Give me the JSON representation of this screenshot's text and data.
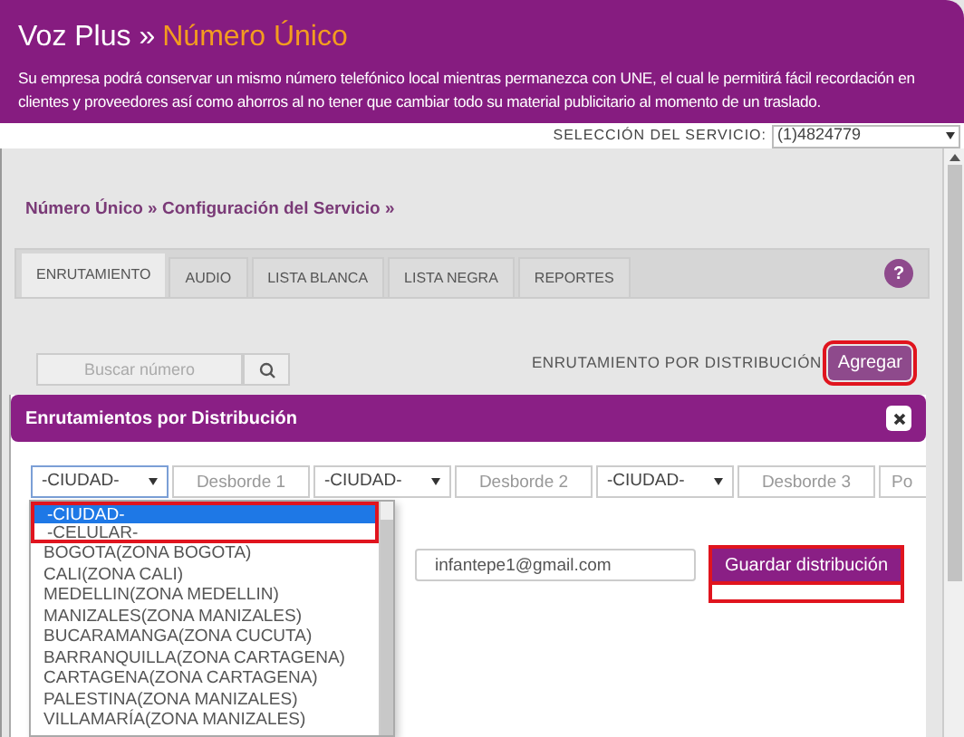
{
  "header": {
    "title": "Voz Plus »",
    "title_highlight": "Número Único",
    "description": "Su empresa podrá conservar un mismo número telefónico local mientras permanezca con UNE, el cual le permitirá fácil recordación en clientes y proveedores así como ahorros al no tener que cambiar todo su material publicitario al momento de un traslado."
  },
  "service_selection": {
    "label": "SELECCIÓN DEL SERVICIO:",
    "value": "(1)4824779"
  },
  "breadcrumb": "Número Único » Configuración del Servicio »",
  "tabs": [
    {
      "label": "ENRUTAMIENTO",
      "selected": true
    },
    {
      "label": "AUDIO",
      "selected": false
    },
    {
      "label": "LISTA BLANCA",
      "selected": false
    },
    {
      "label": "LISTA NEGRA",
      "selected": false
    },
    {
      "label": "REPORTES",
      "selected": false
    }
  ],
  "help_button": "?",
  "search": {
    "placeholder": "Buscar número"
  },
  "distribution": {
    "label": "ENRUTAMIENTO POR DISTRIBUCIÓN",
    "button": "Agregar",
    "highlighted": true
  },
  "dialog": {
    "title": "Enrutamientos por Distribución",
    "fields": [
      {
        "kind": "select",
        "value": "-CIUDAD-",
        "focused": true
      },
      {
        "kind": "input",
        "placeholder": "Desborde 1"
      },
      {
        "kind": "select",
        "value": "-CIUDAD-",
        "focused": false
      },
      {
        "kind": "input",
        "placeholder": "Desborde 2"
      },
      {
        "kind": "select",
        "value": "-CIUDAD-",
        "focused": false
      },
      {
        "kind": "input",
        "placeholder": "Desborde 3"
      },
      {
        "kind": "input",
        "placeholder": "Po"
      }
    ],
    "email": {
      "value": "infantepe1@gmail.com"
    },
    "save_button": {
      "label": "Guardar distribución",
      "highlighted": true
    },
    "dropdown_options": [
      {
        "label": "-CIUDAD-",
        "selected": true,
        "highlighted": true
      },
      {
        "label": "-CELULAR-",
        "selected": false,
        "highlighted": true
      },
      {
        "label": "BOGOTA(ZONA BOGOTA)",
        "selected": false,
        "highlighted": false
      },
      {
        "label": "CALI(ZONA CALI)",
        "selected": false,
        "highlighted": false
      },
      {
        "label": "MEDELLIN(ZONA MEDELLIN)",
        "selected": false,
        "highlighted": false
      },
      {
        "label": "MANIZALES(ZONA MANIZALES)",
        "selected": false,
        "highlighted": false
      },
      {
        "label": "BUCARAMANGA(ZONA CUCUTA)",
        "selected": false,
        "highlighted": false
      },
      {
        "label": "BARRANQUILLA(ZONA CARTAGENA)",
        "selected": false,
        "highlighted": false
      },
      {
        "label": "CARTAGENA(ZONA CARTAGENA)",
        "selected": false,
        "highlighted": false
      },
      {
        "label": "PALESTINA(ZONA MANIZALES)",
        "selected": false,
        "highlighted": false
      },
      {
        "label": "VILLAMARÍA(ZONA MANIZALES)",
        "selected": false,
        "highlighted": false
      }
    ]
  }
}
